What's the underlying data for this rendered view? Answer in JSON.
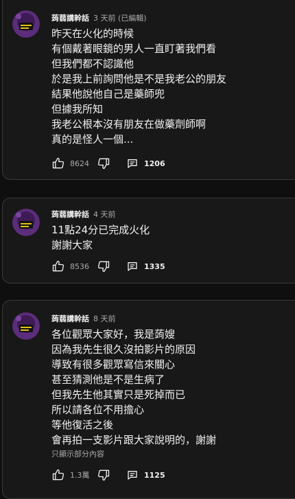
{
  "colors": {
    "background": "#0f0f0f",
    "card": "#181818",
    "border": "#3a3a3a",
    "text_primary": "#f1f1f1",
    "text_secondary": "#aaaaaa",
    "avatar": "#5b2d7a"
  },
  "icons": {
    "like": "thumbs-up-icon",
    "dislike": "thumbs-down-icon",
    "reply": "reply-icon"
  },
  "comments": [
    {
      "author": "蒟蒻講幹話",
      "time": "3 天前 (已編輯)",
      "lines": [
        "昨天在火化的時候",
        "有個戴著眼鏡的男人一直盯著我們看",
        "但我們都不認識他",
        "於是我上前詢問他是不是我老公的朋友",
        "結果他說他自己是藥師兜",
        "但據我所知",
        "我老公根本沒有朋友在做藥劑師啊",
        "真的是怪人一個..."
      ],
      "likes": "8624",
      "replies": "1206"
    },
    {
      "author": "蒟蒻講幹話",
      "time": "4 天前",
      "lines": [
        "11點24分已完成火化",
        "謝謝大家"
      ],
      "likes": "8536",
      "replies": "1335"
    },
    {
      "author": "蒟蒻講幹話",
      "time": "8 天前",
      "lines": [
        "各位觀眾大家好，我是蒟嫂",
        "因為我先生很久沒拍影片的原因",
        "導致有很多觀眾寫信來關心",
        "甚至猜測他是不是生病了",
        "但我先生他其實只是死掉而已",
        "所以請各位不用擔心",
        "等他復活之後",
        "會再拍一支影片跟大家說明的，謝謝"
      ],
      "show_more": "只顯示部分內容",
      "likes": "1.3萬",
      "replies": "1125"
    }
  ]
}
